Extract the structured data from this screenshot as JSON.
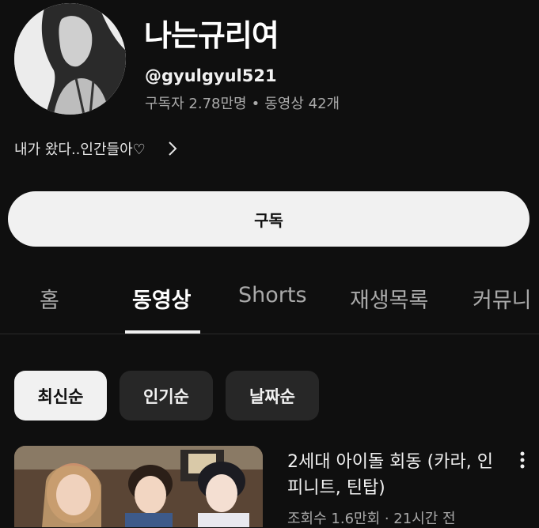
{
  "channel": {
    "name": "나는규리여",
    "handle": "@gyulgyul521",
    "subscribers": "구독자 2.78만명",
    "separator": "•",
    "video_count": "동영상 42개",
    "description": "내가 왔다..인간들아♡"
  },
  "subscribe_label": "구독",
  "tabs": [
    {
      "label": "홈"
    },
    {
      "label": "동영상"
    },
    {
      "label": "Shorts"
    },
    {
      "label": "재생목록"
    },
    {
      "label": "커뮤니"
    }
  ],
  "active_tab": "동영상",
  "filters": [
    {
      "label": "최신순",
      "selected": true
    },
    {
      "label": "인기순",
      "selected": false
    },
    {
      "label": "날짜순",
      "selected": false
    }
  ],
  "videos": [
    {
      "title": "2세대 아이돌 회동 (카라, 인피니트, 틴탑)",
      "meta": "조회수 1.6만회 · 21시간 전"
    }
  ],
  "icons": {
    "chevron": "chevron-right-icon",
    "more": "more-vert-icon"
  },
  "colors": {
    "background": "#0f0f0f",
    "primary_text": "#f1f1f1",
    "secondary_text": "#aaaaaa",
    "chip_bg": "#272727"
  }
}
